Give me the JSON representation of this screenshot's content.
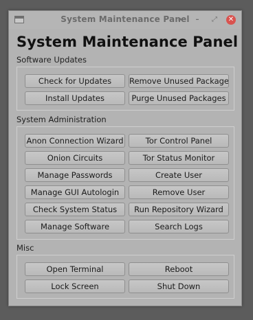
{
  "window": {
    "title": "System Maintenance Panel"
  },
  "titlebar": {
    "app_icon": "window-icon",
    "shade_glyph": "⏶",
    "minimize_glyph": "–",
    "maximize_glyph": "⤢",
    "close_glyph": "✕",
    "close_color": "#d9534f"
  },
  "main": {
    "heading": "System Maintenance Panel"
  },
  "software_updates": {
    "label": "Software Updates",
    "buttons": {
      "check_updates": "Check for Updates",
      "remove_unused": "Remove Unused Packages",
      "install_updates": "Install Updates",
      "purge_unused": "Purge Unused Packages"
    }
  },
  "system_administration": {
    "label": "System Administration",
    "buttons": {
      "anon_wizard": "Anon Connection Wizard",
      "tor_control": "Tor Control Panel",
      "onion_circuits": "Onion Circuits",
      "tor_status": "Tor Status Monitor",
      "manage_passwords": "Manage Passwords",
      "create_user": "Create User",
      "gui_autologin": "Manage GUI Autologin",
      "remove_user": "Remove User",
      "check_status": "Check System Status",
      "repo_wizard": "Run Repository Wizard",
      "manage_software": "Manage Software",
      "search_logs": "Search Logs"
    }
  },
  "misc": {
    "label": "Misc",
    "buttons": {
      "open_terminal": "Open Terminal",
      "reboot": "Reboot",
      "lock_screen": "Lock Screen",
      "shut_down": "Shut Down"
    }
  }
}
